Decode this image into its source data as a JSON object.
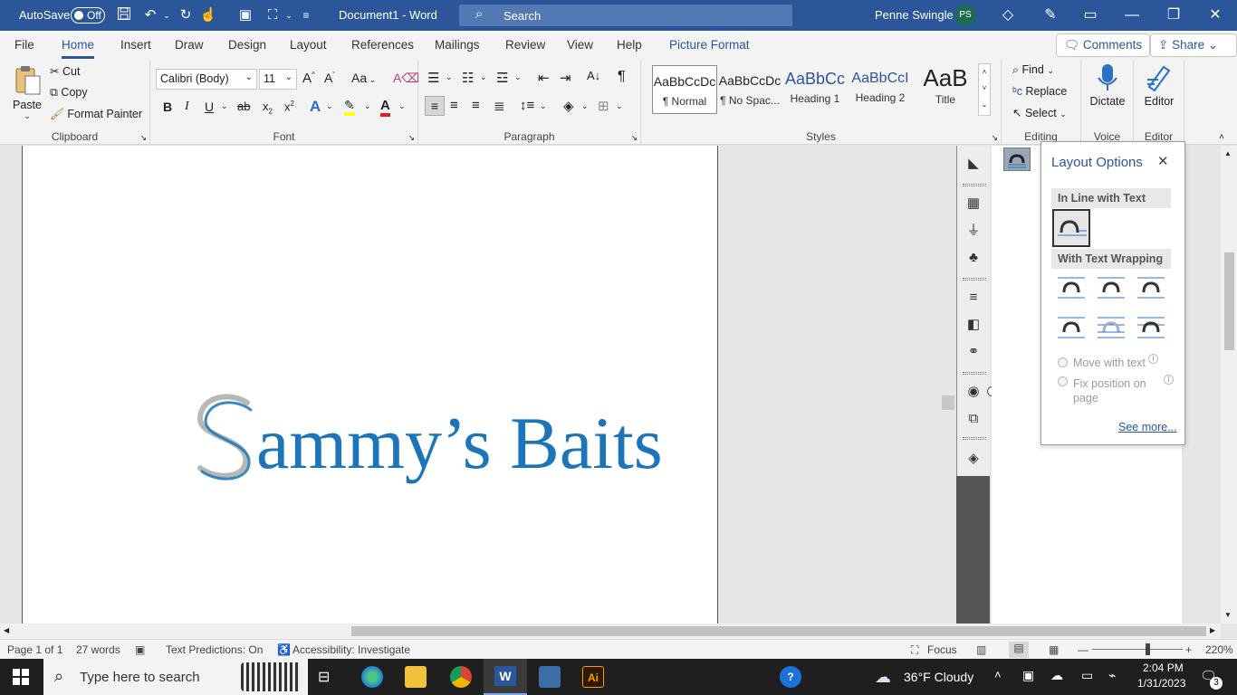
{
  "titlebar": {
    "autosave_label": "AutoSave",
    "autosave_state": "Off",
    "doc_title": "Document1  -  Word",
    "search_placeholder": "Search",
    "user_name": "Penne Swingle",
    "user_initials": "PS"
  },
  "tabs": [
    "File",
    "Home",
    "Insert",
    "Draw",
    "Design",
    "Layout",
    "References",
    "Mailings",
    "Review",
    "View",
    "Help",
    "Picture Format"
  ],
  "actions": {
    "comments": "Comments",
    "share": "Share"
  },
  "clipboard": {
    "paste": "Paste",
    "cut": "Cut",
    "copy": "Copy",
    "format_painter": "Format Painter",
    "label": "Clipboard"
  },
  "font": {
    "name": "Calibri (Body)",
    "size": "11",
    "label": "Font",
    "change_case": "Aa"
  },
  "paragraph": {
    "label": "Paragraph"
  },
  "styles": {
    "label": "Styles",
    "items": [
      {
        "preview": "AaBbCcDc",
        "name": "¶ Normal"
      },
      {
        "preview": "AaBbCcDc",
        "name": "¶ No Spac..."
      },
      {
        "preview": "AaBbCc",
        "name": "Heading 1"
      },
      {
        "preview": "AaBbCcI",
        "name": "Heading 2"
      },
      {
        "preview": "AaB",
        "name": "Title"
      }
    ]
  },
  "editing": {
    "find": "Find",
    "replace": "Replace",
    "select": "Select",
    "label": "Editing"
  },
  "voice": {
    "dictate": "Dictate",
    "label": "Voice"
  },
  "editor": {
    "editor": "Editor",
    "label": "Editor"
  },
  "document": {
    "wordart_text": "Sammy’s Baits"
  },
  "layout_options": {
    "title": "Layout Options",
    "inline_header": "In Line with Text",
    "wrapping_header": "With Text Wrapping",
    "move_with_text": "Move with text",
    "fix_position": "Fix position on page",
    "see_more": "See more..."
  },
  "status": {
    "page": "Page 1 of 1",
    "words": "27 words",
    "predictions": "Text Predictions: On",
    "accessibility": "Accessibility: Investigate",
    "focus": "Focus",
    "zoom": "220%"
  },
  "taskbar": {
    "search_placeholder": "Type here to search",
    "weather": "36°F  Cloudy",
    "time": "2:04 PM",
    "date": "1/31/2023",
    "notifications": "3"
  },
  "colors": {
    "word_blue": "#2b579a",
    "wordart_blue": "#1b75b8"
  }
}
